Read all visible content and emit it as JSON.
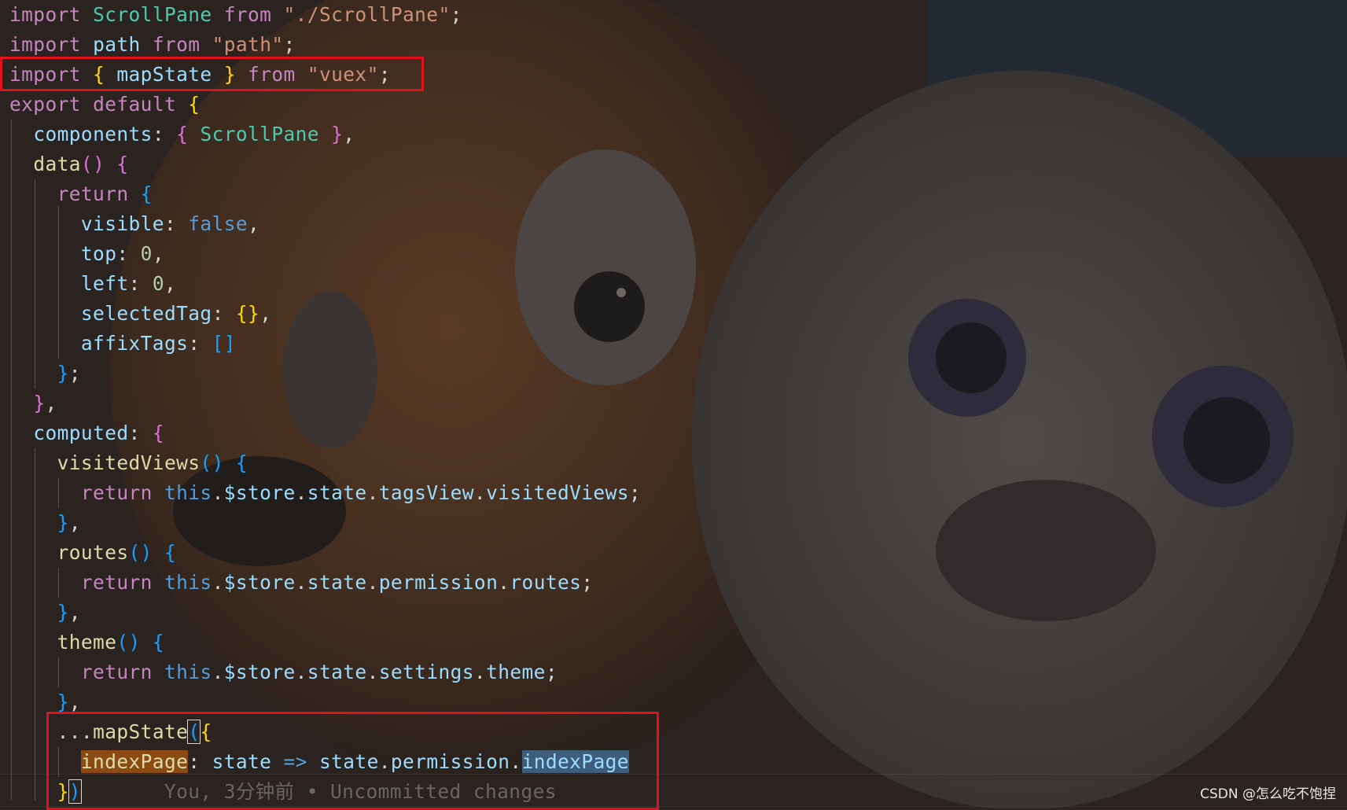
{
  "editor": {
    "lines": [
      [
        [
          "kw",
          "import"
        ],
        [
          "pun",
          " "
        ],
        [
          "cls",
          "ScrollPane"
        ],
        [
          "pun",
          " "
        ],
        [
          "kw",
          "from"
        ],
        [
          "pun",
          " "
        ],
        [
          "str",
          "\"./ScrollPane\""
        ],
        [
          "pun",
          ";"
        ]
      ],
      [
        [
          "kw",
          "import"
        ],
        [
          "pun",
          " "
        ],
        [
          "var",
          "path"
        ],
        [
          "pun",
          " "
        ],
        [
          "kw",
          "from"
        ],
        [
          "pun",
          " "
        ],
        [
          "str",
          "\"path\""
        ],
        [
          "pun",
          ";"
        ]
      ],
      [
        [
          "kw",
          "import"
        ],
        [
          "pun",
          " "
        ],
        [
          "br1",
          "{"
        ],
        [
          "pun",
          " "
        ],
        [
          "var",
          "mapState"
        ],
        [
          "pun",
          " "
        ],
        [
          "br1",
          "}"
        ],
        [
          "pun",
          " "
        ],
        [
          "kw",
          "from"
        ],
        [
          "pun",
          " "
        ],
        [
          "str",
          "\"vuex\""
        ],
        [
          "pun",
          ";"
        ]
      ],
      [
        [
          "kw",
          "export"
        ],
        [
          "pun",
          " "
        ],
        [
          "kw",
          "default"
        ],
        [
          "pun",
          " "
        ],
        [
          "br1",
          "{"
        ]
      ],
      [
        [
          "pun",
          "  "
        ],
        [
          "var",
          "components"
        ],
        [
          "pun",
          ": "
        ],
        [
          "br2",
          "{"
        ],
        [
          "pun",
          " "
        ],
        [
          "cls",
          "ScrollPane"
        ],
        [
          "pun",
          " "
        ],
        [
          "br2",
          "}"
        ],
        [
          "pun",
          ","
        ]
      ],
      [
        [
          "pun",
          "  "
        ],
        [
          "fn",
          "data"
        ],
        [
          "br2",
          "()"
        ],
        [
          "pun",
          " "
        ],
        [
          "br2",
          "{"
        ]
      ],
      [
        [
          "pun",
          "    "
        ],
        [
          "kw",
          "return"
        ],
        [
          "pun",
          " "
        ],
        [
          "br3",
          "{"
        ]
      ],
      [
        [
          "pun",
          "      "
        ],
        [
          "var",
          "visible"
        ],
        [
          "pun",
          ": "
        ],
        [
          "kwb",
          "false"
        ],
        [
          "pun",
          ","
        ]
      ],
      [
        [
          "pun",
          "      "
        ],
        [
          "var",
          "top"
        ],
        [
          "pun",
          ": "
        ],
        [
          "num",
          "0"
        ],
        [
          "pun",
          ","
        ]
      ],
      [
        [
          "pun",
          "      "
        ],
        [
          "var",
          "left"
        ],
        [
          "pun",
          ": "
        ],
        [
          "num",
          "0"
        ],
        [
          "pun",
          ","
        ]
      ],
      [
        [
          "pun",
          "      "
        ],
        [
          "var",
          "selectedTag"
        ],
        [
          "pun",
          ": "
        ],
        [
          "br1",
          "{}"
        ],
        [
          "pun",
          ","
        ]
      ],
      [
        [
          "pun",
          "      "
        ],
        [
          "var",
          "affixTags"
        ],
        [
          "pun",
          ": "
        ],
        [
          "br3",
          "[]"
        ]
      ],
      [
        [
          "pun",
          "    "
        ],
        [
          "br3",
          "}"
        ],
        [
          "pun",
          ";"
        ]
      ],
      [
        [
          "pun",
          "  "
        ],
        [
          "br2",
          "}"
        ],
        [
          "pun",
          ","
        ]
      ],
      [
        [
          "pun",
          "  "
        ],
        [
          "var",
          "computed"
        ],
        [
          "pun",
          ": "
        ],
        [
          "br2",
          "{"
        ]
      ],
      [
        [
          "pun",
          "    "
        ],
        [
          "fn",
          "visitedViews"
        ],
        [
          "br3",
          "()"
        ],
        [
          "pun",
          " "
        ],
        [
          "br3",
          "{"
        ]
      ],
      [
        [
          "pun",
          "      "
        ],
        [
          "kw",
          "return"
        ],
        [
          "pun",
          " "
        ],
        [
          "kwb",
          "this"
        ],
        [
          "pun",
          "."
        ],
        [
          "var",
          "$store"
        ],
        [
          "pun",
          "."
        ],
        [
          "var",
          "state"
        ],
        [
          "pun",
          "."
        ],
        [
          "var",
          "tagsView"
        ],
        [
          "pun",
          "."
        ],
        [
          "var",
          "visitedViews"
        ],
        [
          "pun",
          ";"
        ]
      ],
      [
        [
          "pun",
          "    "
        ],
        [
          "br3",
          "}"
        ],
        [
          "pun",
          ","
        ]
      ],
      [
        [
          "pun",
          "    "
        ],
        [
          "fn",
          "routes"
        ],
        [
          "br3",
          "()"
        ],
        [
          "pun",
          " "
        ],
        [
          "br3",
          "{"
        ]
      ],
      [
        [
          "pun",
          "      "
        ],
        [
          "kw",
          "return"
        ],
        [
          "pun",
          " "
        ],
        [
          "kwb",
          "this"
        ],
        [
          "pun",
          "."
        ],
        [
          "var",
          "$store"
        ],
        [
          "pun",
          "."
        ],
        [
          "var",
          "state"
        ],
        [
          "pun",
          "."
        ],
        [
          "var",
          "permission"
        ],
        [
          "pun",
          "."
        ],
        [
          "var",
          "routes"
        ],
        [
          "pun",
          ";"
        ]
      ],
      [
        [
          "pun",
          "    "
        ],
        [
          "br3",
          "}"
        ],
        [
          "pun",
          ","
        ]
      ],
      [
        [
          "pun",
          "    "
        ],
        [
          "fn",
          "theme"
        ],
        [
          "br3",
          "()"
        ],
        [
          "pun",
          " "
        ],
        [
          "br3",
          "{"
        ]
      ],
      [
        [
          "pun",
          "      "
        ],
        [
          "kw",
          "return"
        ],
        [
          "pun",
          " "
        ],
        [
          "kwb",
          "this"
        ],
        [
          "pun",
          "."
        ],
        [
          "var",
          "$store"
        ],
        [
          "pun",
          "."
        ],
        [
          "var",
          "state"
        ],
        [
          "pun",
          "."
        ],
        [
          "var",
          "settings"
        ],
        [
          "pun",
          "."
        ],
        [
          "var",
          "theme"
        ],
        [
          "pun",
          ";"
        ]
      ],
      [
        [
          "pun",
          "    "
        ],
        [
          "br3",
          "}"
        ],
        [
          "pun",
          ","
        ]
      ],
      [
        [
          "pun",
          "    ..."
        ],
        [
          "fn",
          "mapState"
        ],
        [
          "br3 cursor-box",
          "("
        ],
        [
          "br1",
          "{"
        ]
      ],
      [
        [
          "pun",
          "      "
        ],
        [
          "hl-word",
          "indexPage"
        ],
        [
          "pun",
          ": "
        ],
        [
          "var",
          "state"
        ],
        [
          "pun",
          " "
        ],
        [
          "kwb",
          "=>"
        ],
        [
          "pun",
          " "
        ],
        [
          "var",
          "state"
        ],
        [
          "pun",
          "."
        ],
        [
          "var",
          "permission"
        ],
        [
          "pun",
          "."
        ],
        [
          "var hl-sel",
          "indexPage"
        ]
      ],
      [
        [
          "pun",
          "    "
        ],
        [
          "br1",
          "}"
        ],
        [
          "br3 cursor-box",
          ")"
        ],
        [
          "pun",
          "       "
        ],
        [
          "ghost",
          "You, 3分钟前 • Uncommitted changes"
        ]
      ]
    ]
  },
  "watermark": "CSDN @怎么吃不饱捏",
  "colors": {
    "highlight_box": "#e0101c",
    "background": "#2a2320"
  }
}
